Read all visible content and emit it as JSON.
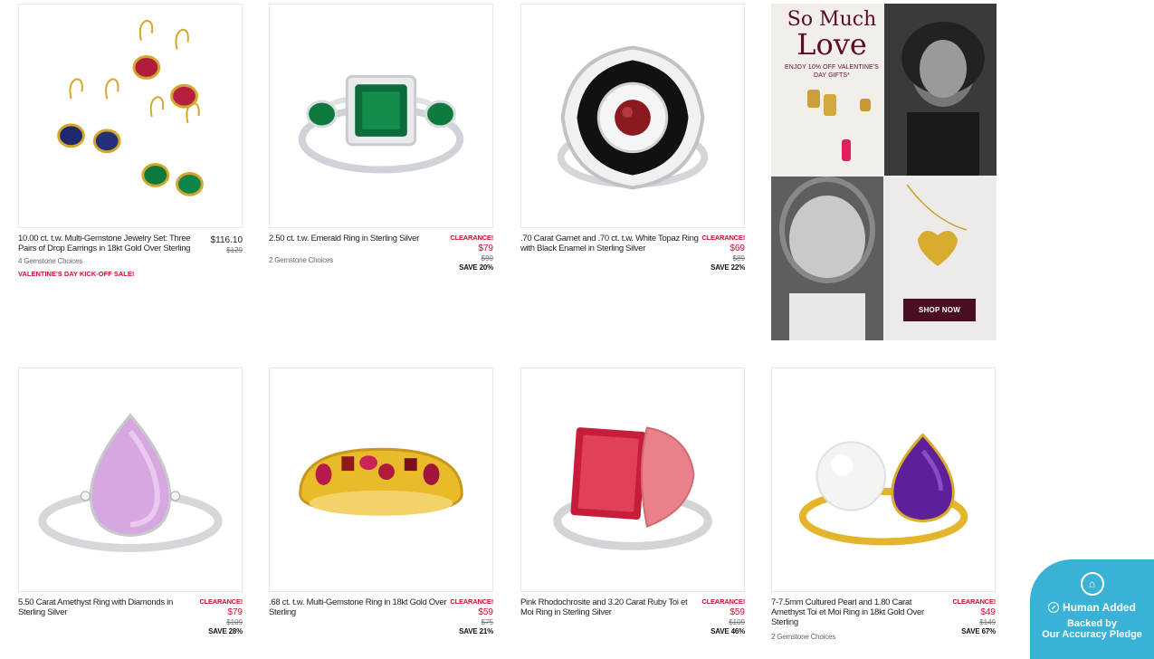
{
  "products": [
    {
      "title": "10.00 ct. t.w. Multi-Gemstone Jewelry Set: Three Pairs of Drop Earrings in 18kt Gold Over Sterling",
      "choices": "4 Gemstone Choices",
      "promo": "VALENTINE'S DAY KICK-OFF SALE!",
      "clearance": "",
      "price": "$116.10",
      "old_price": "$129",
      "save": "",
      "image": "earrings-set"
    },
    {
      "title": "2.50 ct. t.w. Emerald Ring in Sterling Silver",
      "choices": "2 Gemstone Choices",
      "promo": "",
      "clearance": "CLEARANCE!",
      "price": "$79",
      "old_price": "$99",
      "save": "SAVE 20%",
      "image": "emerald-ring"
    },
    {
      "title": ".70 Carat Garnet and .70 ct. t.w. White Topaz Ring with Black Enamel in Sterling Silver",
      "choices": "",
      "promo": "",
      "clearance": "CLEARANCE!",
      "price": "$69",
      "old_price": "$89",
      "save": "SAVE 22%",
      "image": "garnet-ring"
    },
    {
      "title": "5.50 Carat Amethyst Ring with Diamonds in Sterling Silver",
      "choices": "",
      "promo": "",
      "clearance": "CLEARANCE!",
      "price": "$79",
      "old_price": "$109",
      "save": "SAVE 28%",
      "image": "amethyst-ring"
    },
    {
      "title": ".68 ct. t.w. Multi-Gemstone Ring in 18kt Gold Over Sterling",
      "choices": "",
      "promo": "",
      "clearance": "CLEARANCE!",
      "price": "$59",
      "old_price": "$75",
      "save": "SAVE 21%",
      "image": "gold-band"
    },
    {
      "title": "Pink Rhodochrosite and 3.20 Carat Ruby Toi et Moi Ring in Sterling Silver",
      "choices": "",
      "promo": "",
      "clearance": "CLEARANCE!",
      "price": "$59",
      "old_price": "$109",
      "save": "SAVE 46%",
      "image": "ruby-ring"
    },
    {
      "title": "7-7.5mm Cultured Pearl and 1.80 Carat Amethyst Toi et Moi Ring in 18kt Gold Over Sterling",
      "choices": "2 Gemstone Choices",
      "promo": "",
      "clearance": "CLEARANCE!",
      "price": "$49",
      "old_price": "$149",
      "save": "SAVE 67%",
      "image": "pearl-ring"
    }
  ],
  "promo_tile": {
    "headline_line1": "So Much",
    "headline_line2": "Love",
    "subtext": "ENJOY 10% OFF VALENTINE'S DAY GIFTS*",
    "cta": "SHOP NOW"
  },
  "badge": {
    "title": "Human Added",
    "line1": "Backed by",
    "line2": "Our Accuracy Pledge"
  },
  "colors": {
    "sale_red": "#c8102e",
    "promo_burgundy": "#4a0e24",
    "badge_blue": "#3ab2d6"
  }
}
